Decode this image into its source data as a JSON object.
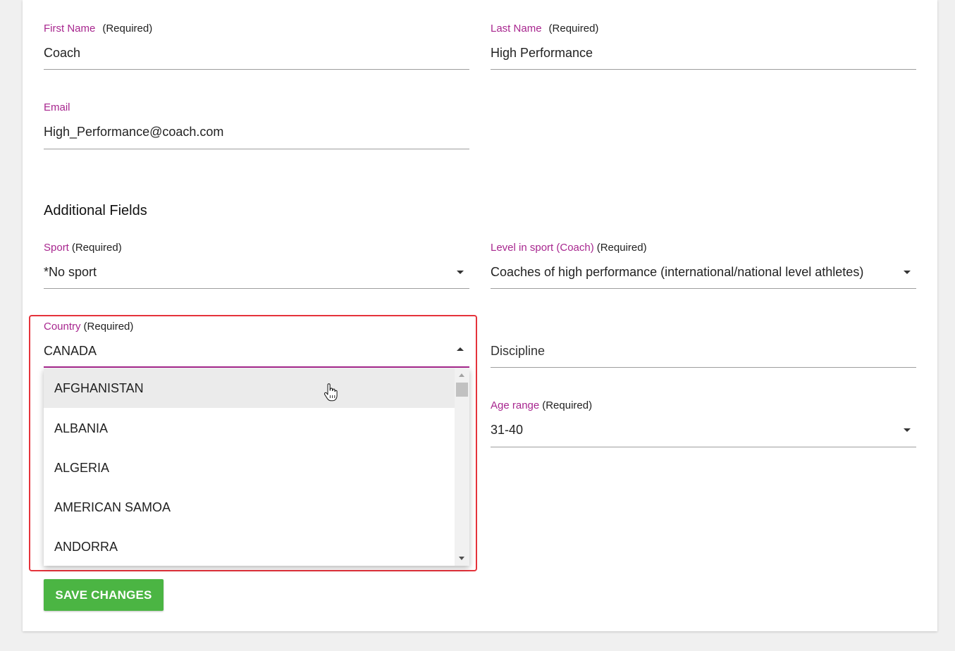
{
  "profile": {
    "first_name": {
      "label": "First Name",
      "required": "(Required)",
      "value": "Coach"
    },
    "last_name": {
      "label": "Last Name",
      "required": "(Required)",
      "value": "High Performance"
    },
    "email": {
      "label": "Email",
      "value": "High_Performance@coach.com"
    }
  },
  "additional": {
    "title": "Additional Fields",
    "sport": {
      "label": "Sport",
      "required": "(Required)",
      "value": "*No sport"
    },
    "level": {
      "label": "Level in sport (Coach)",
      "required": "(Required)",
      "value": "Coaches of high performance (international/national level athletes)"
    },
    "country": {
      "label": "Country",
      "required": "(Required)",
      "value": "CANADA",
      "options": [
        "AFGHANISTAN",
        "ALBANIA",
        "ALGERIA",
        "AMERICAN SAMOA",
        "ANDORRA"
      ],
      "hovered_option": "AFGHANISTAN"
    },
    "discipline": {
      "placeholder": "Discipline"
    },
    "age_range": {
      "label": "Age range",
      "required": "(Required)",
      "value": "31-40"
    }
  },
  "actions": {
    "save_label": "SAVE CHANGES"
  },
  "colors": {
    "label_accent": "#a8278f",
    "save_button": "#4bb543",
    "highlight_border": "#e5333b"
  },
  "icons": [
    "caret-down-icon",
    "caret-up-icon",
    "hand-pointer-cursor-icon"
  ]
}
